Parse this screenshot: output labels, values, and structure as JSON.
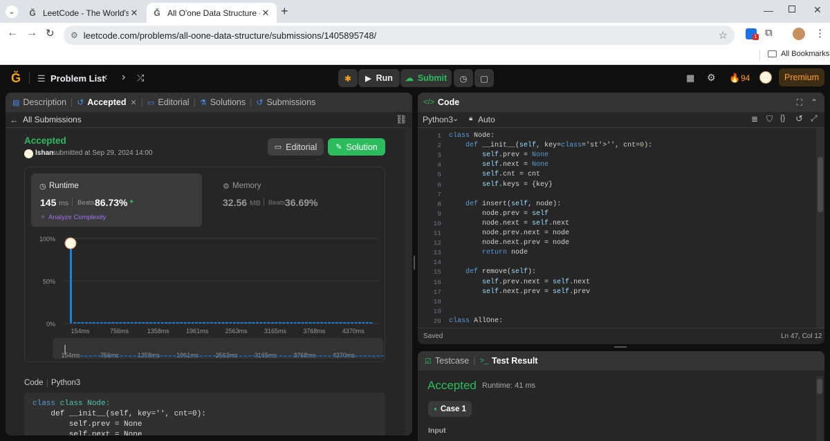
{
  "browser": {
    "tabs": [
      {
        "title": "LeetCode - The World's Leading",
        "active": false
      },
      {
        "title": "All O'one Data Structure - LeetC",
        "active": true
      }
    ],
    "url": "leetcode.com/problems/all-oone-data-structure/submissions/1405895748/",
    "bookmarks_label": "All Bookmarks"
  },
  "nav": {
    "problem_list": "Problem List",
    "run": "Run",
    "submit": "Submit",
    "streak": "94",
    "premium": "Premium"
  },
  "left_tabs": [
    "Description",
    "Accepted",
    "Editorial",
    "Solutions",
    "Submissions"
  ],
  "submission": {
    "back": "All Submissions",
    "status": "Accepted",
    "user": "lshan",
    "submitted": "submitted at Sep 29, 2024 14:00",
    "editorial_btn": "Editorial",
    "solution_btn": "Solution",
    "runtime_label": "Runtime",
    "runtime_value": "145",
    "runtime_unit": "ms",
    "beats_label": "Beats",
    "runtime_beats": "86.73%",
    "analyze": "Analyze Complexity",
    "memory_label": "Memory",
    "memory_value": "32.56",
    "memory_unit": "MB",
    "memory_beats": "36.69%",
    "code_label": "Code",
    "code_lang": "Python3"
  },
  "chart_data": {
    "type": "bar",
    "ylabels": [
      "100%",
      "50%",
      "0%"
    ],
    "categories": [
      "154ms",
      "756ms",
      "1358ms",
      "1961ms",
      "2563ms",
      "3165ms",
      "3768ms",
      "4370ms"
    ],
    "values": [
      0.92,
      0.012,
      0.012,
      0.012,
      0.012,
      0.012,
      0.012,
      0.012,
      0.012,
      0.012,
      0.012,
      0.012,
      0.012,
      0.012,
      0.012,
      0.012,
      0.012,
      0.012,
      0.012,
      0.012,
      0.012,
      0.012,
      0.012,
      0.012,
      0.012,
      0.012,
      0.012,
      0.012,
      0.012,
      0.012,
      0.012,
      0.012,
      0.012,
      0.012,
      0.012,
      0.012,
      0.012,
      0.012,
      0.012,
      0.012,
      0.012,
      0.012,
      0.012,
      0.012,
      0.012,
      0.012,
      0.012,
      0.012,
      0.012,
      0.012,
      0.012,
      0.012,
      0.012,
      0.012,
      0.012,
      0.012,
      0.012,
      0.012,
      0.012,
      0.012,
      0.012,
      0.012,
      0.012,
      0.012,
      0.012,
      0.012,
      0.012,
      0.012,
      0.012,
      0.012,
      0.012,
      0.012,
      0.012,
      0.012,
      0.012,
      0.012,
      0.012,
      0.012,
      0.012,
      0.012
    ],
    "ylim": [
      0,
      1
    ],
    "bar_color": "#1a7ddc"
  },
  "left_code": [
    "class Node:",
    "    def __init__(self, key='', cnt=0):",
    "        self.prev = None",
    "        self.next = None"
  ],
  "code_panel": {
    "title": "Code",
    "lang": "Python3",
    "mode": "Auto",
    "status": "Saved",
    "cursor": "Ln 47, Col 12",
    "lines": [
      "class Node:",
      "    def __init__(self, key='', cnt=0):",
      "        self.prev = None",
      "        self.next = None",
      "        self.cnt = cnt",
      "        self.keys = {key}",
      "",
      "    def insert(self, node):",
      "        node.prev = self",
      "        node.next = self.next",
      "        node.prev.next = node",
      "        node.next.prev = node",
      "        return node",
      "",
      "    def remove(self):",
      "        self.prev.next = self.next",
      "        self.next.prev = self.prev",
      "",
      "",
      "class AllOne:"
    ]
  },
  "result_panel": {
    "tab_testcase": "Testcase",
    "tab_result": "Test Result",
    "status": "Accepted",
    "runtime": "Runtime: 41 ms",
    "case": "Case 1",
    "input_label": "Input"
  },
  "colors": {
    "accent_green": "#2cbb5d",
    "accent_orange": "#ffa116",
    "bar_blue": "#1a7ddc"
  }
}
